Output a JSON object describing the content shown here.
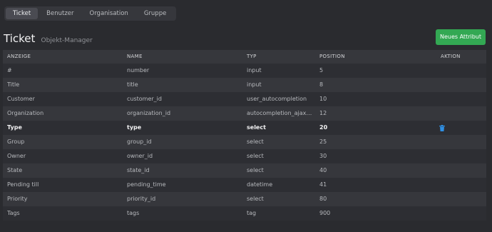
{
  "tabs": [
    "Ticket",
    "Benutzer",
    "Organisation",
    "Gruppe"
  ],
  "header": {
    "title": "Ticket",
    "subtitle": "Objekt-Manager",
    "new_button": "Neues Attribut"
  },
  "table": {
    "columns": [
      "ANZEIGE",
      "NAME",
      "TYP",
      "POSITION",
      "AKTION"
    ],
    "rows": [
      {
        "display": "#",
        "name": "number",
        "type": "input",
        "position": "5"
      },
      {
        "display": "Title",
        "name": "title",
        "type": "input",
        "position": "8"
      },
      {
        "display": "Customer",
        "name": "customer_id",
        "type": "user_autocompletion",
        "position": "10"
      },
      {
        "display": "Organization",
        "name": "organization_id",
        "type": "autocompletion_ajax_cust…",
        "position": "12"
      },
      {
        "display": "Type",
        "name": "type",
        "type": "select",
        "position": "20"
      },
      {
        "display": "Group",
        "name": "group_id",
        "type": "select",
        "position": "25"
      },
      {
        "display": "Owner",
        "name": "owner_id",
        "type": "select",
        "position": "30"
      },
      {
        "display": "State",
        "name": "state_id",
        "type": "select",
        "position": "40"
      },
      {
        "display": "Pending till",
        "name": "pending_time",
        "type": "datetime",
        "position": "41"
      },
      {
        "display": "Priority",
        "name": "priority_id",
        "type": "select",
        "position": "80"
      },
      {
        "display": "Tags",
        "name": "tags",
        "type": "tag",
        "position": "900"
      }
    ]
  },
  "colors": {
    "accent": "#33a853",
    "trash_icon": "#2f8fe3",
    "background": "#2a2b2f"
  },
  "icons": {
    "delete": "trash-icon"
  }
}
